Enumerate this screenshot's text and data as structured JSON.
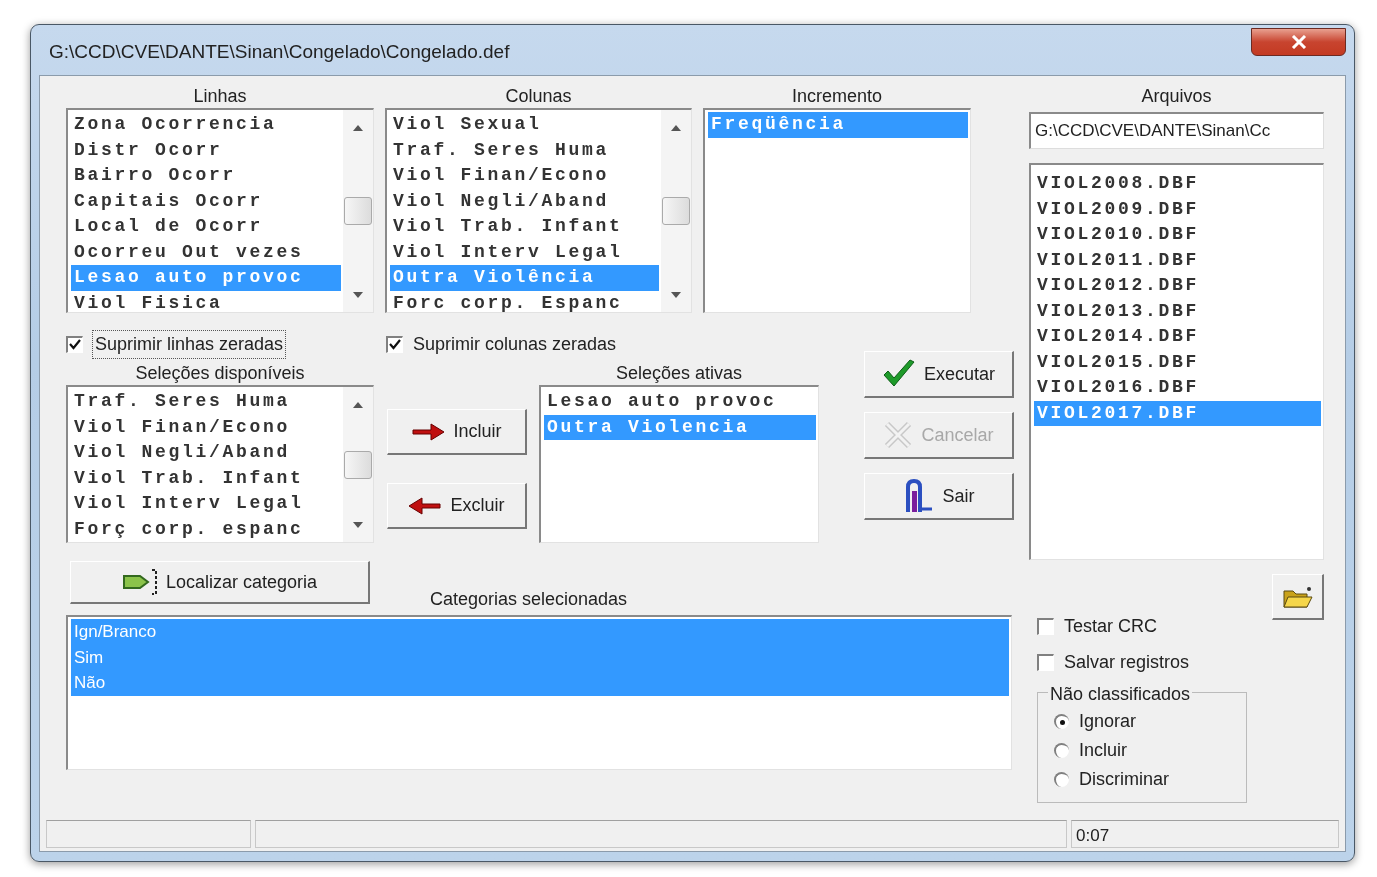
{
  "window": {
    "title": "G:\\CCD\\CVE\\DANTE\\Sinan\\Congelado\\Congelado.def"
  },
  "linhas": {
    "label": "Linhas",
    "scrollbar": true,
    "items": [
      {
        "text": "Zona Ocorrencia",
        "selected": false
      },
      {
        "text": "Distr Ocorr",
        "selected": false
      },
      {
        "text": "Bairro Ocorr",
        "selected": false
      },
      {
        "text": "Capitais Ocorr",
        "selected": false
      },
      {
        "text": "Local de Ocorr",
        "selected": false
      },
      {
        "text": "Ocorreu Out vezes",
        "selected": false
      },
      {
        "text": "Lesao auto provoc",
        "selected": true
      },
      {
        "text": "Viol Fisica",
        "selected": false
      }
    ]
  },
  "colunas": {
    "label": "Colunas",
    "scrollbar": true,
    "items": [
      {
        "text": "Viol Sexual",
        "selected": false
      },
      {
        "text": "Traf. Seres Huma",
        "selected": false
      },
      {
        "text": "Viol Finan/Econo",
        "selected": false
      },
      {
        "text": "Viol Negli/Aband",
        "selected": false
      },
      {
        "text": "Viol Trab. Infant",
        "selected": false
      },
      {
        "text": "Viol Interv Legal",
        "selected": false
      },
      {
        "text": "Outra Violência",
        "selected": true
      },
      {
        "text": "Forc corp. Espanc",
        "selected": false
      }
    ]
  },
  "incremento": {
    "label": "Incremento",
    "items": [
      {
        "text": "Freqüência",
        "selected": true
      }
    ]
  },
  "arquivos": {
    "label": "Arquivos",
    "path": "G:\\CCD\\CVE\\DANTE\\Sinan\\Cc",
    "items": [
      {
        "text": "VIOL2008.DBF",
        "selected": false
      },
      {
        "text": "VIOL2009.DBF",
        "selected": false
      },
      {
        "text": "VIOL2010.DBF",
        "selected": false
      },
      {
        "text": "VIOL2011.DBF",
        "selected": false
      },
      {
        "text": "VIOL2012.DBF",
        "selected": false
      },
      {
        "text": "VIOL2013.DBF",
        "selected": false
      },
      {
        "text": "VIOL2014.DBF",
        "selected": false
      },
      {
        "text": "VIOL2015.DBF",
        "selected": false
      },
      {
        "text": "VIOL2016.DBF",
        "selected": false
      },
      {
        "text": "VIOL2017.DBF",
        "selected": true
      }
    ]
  },
  "suppress_options": [
    {
      "label": "Suprimir linhas zeradas",
      "checked": true,
      "focused": true
    },
    {
      "label": "Suprimir colunas zeradas",
      "checked": true,
      "focused": false
    }
  ],
  "selecoes_disponiveis": {
    "label": "Seleções disponíveis",
    "scrollbar": true,
    "items": [
      {
        "text": "Traf. Seres Huma",
        "selected": false
      },
      {
        "text": "Viol Finan/Econo",
        "selected": false
      },
      {
        "text": "Viol Negli/Aband",
        "selected": false
      },
      {
        "text": "Viol Trab. Infant",
        "selected": false
      },
      {
        "text": "Viol Interv Legal",
        "selected": false
      },
      {
        "text": "Forç corp. espanc",
        "selected": false
      }
    ]
  },
  "move_buttons": [
    {
      "label": "Incluir",
      "kind": "arrow-right"
    },
    {
      "label": "Excluir",
      "kind": "arrow-left"
    }
  ],
  "selecoes_ativas": {
    "label": "Seleções ativas",
    "items": [
      {
        "text": "Lesao auto provoc",
        "selected": false
      },
      {
        "text": "Outra Violencia",
        "selected": true
      }
    ]
  },
  "action_buttons": [
    {
      "label": "Executar",
      "kind": "check",
      "disabled": false
    },
    {
      "label": "Cancelar",
      "kind": "cross",
      "disabled": true
    },
    {
      "label": "Sair",
      "kind": "exit",
      "disabled": false
    }
  ],
  "localizar_button": {
    "label": "Localizar categoria",
    "kind": "locate"
  },
  "categorias": {
    "label": "Categorias selecionadas",
    "items": [
      {
        "text": "Ign/Branco",
        "selected": true
      },
      {
        "text": "Sim",
        "selected": true
      },
      {
        "text": "Não",
        "selected": true
      }
    ]
  },
  "file_options": [
    {
      "label": "Testar CRC",
      "checked": false
    },
    {
      "label": "Salvar registros",
      "checked": false
    }
  ],
  "nao_classificados": {
    "label": "Não classificados",
    "options": [
      {
        "label": "Ignorar",
        "selected": true
      },
      {
        "label": "Incluir",
        "selected": false
      },
      {
        "label": "Discriminar",
        "selected": false
      }
    ]
  },
  "status_bar": {
    "time": "0:07"
  }
}
